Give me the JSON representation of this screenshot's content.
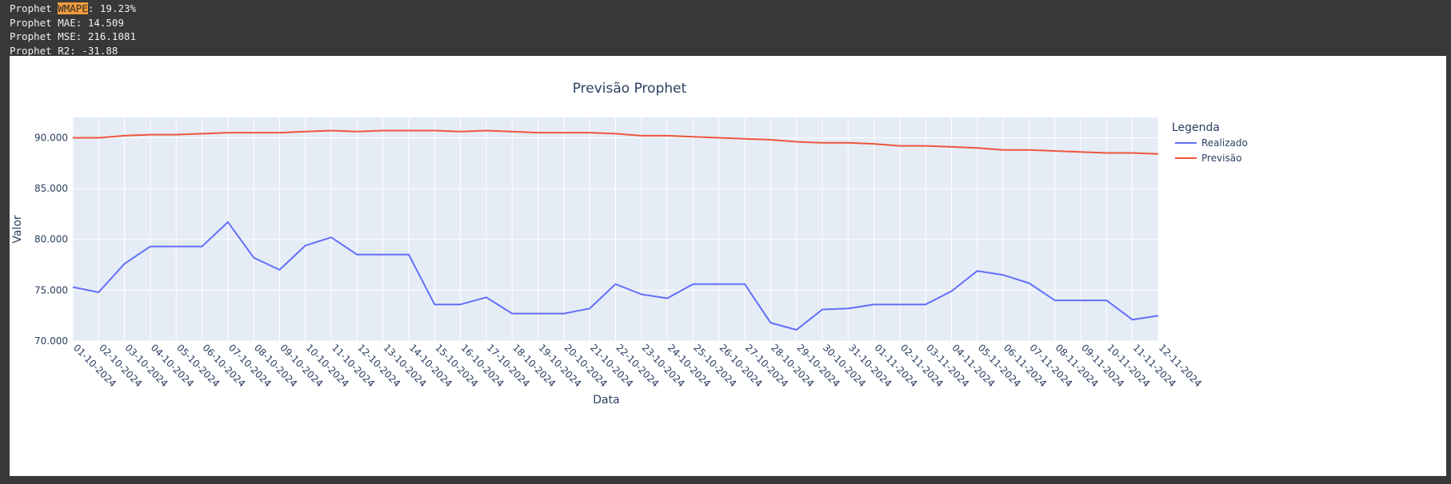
{
  "console": {
    "line1_prefix": "Prophet ",
    "line1_highlight": "WMAPE",
    "line1_suffix": ": 19.23%",
    "line2": "Prophet MAE: 14.509",
    "line3": "Prophet MSE: 216.1081",
    "line4": "Prophet R2: -31.88"
  },
  "colors": {
    "plot_bg": "#e5ecf6",
    "realizado": "#636efa",
    "previsao": "#ef553b",
    "highlight": "#f09b3c"
  },
  "chart_data": {
    "type": "line",
    "title": "Previsão Prophet",
    "xlabel": "Data",
    "ylabel": "Valor",
    "ylim": [
      70,
      92
    ],
    "yticks": [
      70,
      75,
      80,
      85,
      90
    ],
    "ytick_labels": [
      "70.000",
      "75.000",
      "80.000",
      "85.000",
      "90.000"
    ],
    "grid": true,
    "legend": {
      "title": "Legenda",
      "placement": "top-right"
    },
    "x": [
      "01-10-2024",
      "02-10-2024",
      "03-10-2024",
      "04-10-2024",
      "05-10-2024",
      "06-10-2024",
      "07-10-2024",
      "08-10-2024",
      "09-10-2024",
      "10-10-2024",
      "11-10-2024",
      "12-10-2024",
      "13-10-2024",
      "14-10-2024",
      "15-10-2024",
      "16-10-2024",
      "17-10-2024",
      "18-10-2024",
      "19-10-2024",
      "20-10-2024",
      "21-10-2024",
      "22-10-2024",
      "23-10-2024",
      "24-10-2024",
      "25-10-2024",
      "26-10-2024",
      "27-10-2024",
      "28-10-2024",
      "29-10-2024",
      "30-10-2024",
      "31-10-2024",
      "01-11-2024",
      "02-11-2024",
      "03-11-2024",
      "04-11-2024",
      "05-11-2024",
      "06-11-2024",
      "07-11-2024",
      "08-11-2024",
      "09-11-2024",
      "10-11-2024",
      "11-11-2024",
      "12-11-2024"
    ],
    "series": [
      {
        "name": "Realizado",
        "values": [
          75.3,
          74.8,
          77.6,
          79.3,
          79.3,
          79.3,
          81.7,
          78.2,
          77.0,
          79.4,
          80.2,
          78.5,
          78.5,
          78.5,
          73.6,
          73.6,
          74.3,
          72.7,
          72.7,
          72.7,
          73.2,
          75.6,
          74.6,
          74.2,
          75.6,
          75.6,
          75.6,
          71.8,
          71.1,
          73.1,
          73.2,
          73.6,
          73.6,
          73.6,
          74.9,
          76.9,
          76.5,
          75.7,
          74.0,
          74.0,
          74.0,
          72.1,
          72.5
        ]
      },
      {
        "name": "Previsão",
        "values": [
          90.0,
          90.0,
          90.2,
          90.3,
          90.3,
          90.4,
          90.5,
          90.5,
          90.5,
          90.6,
          90.7,
          90.6,
          90.7,
          90.7,
          90.7,
          90.6,
          90.7,
          90.6,
          90.5,
          90.5,
          90.5,
          90.4,
          90.2,
          90.2,
          90.1,
          90.0,
          89.9,
          89.8,
          89.6,
          89.5,
          89.5,
          89.4,
          89.2,
          89.2,
          89.1,
          89.0,
          88.8,
          88.8,
          88.7,
          88.6,
          88.5,
          88.5,
          88.4
        ]
      }
    ]
  }
}
